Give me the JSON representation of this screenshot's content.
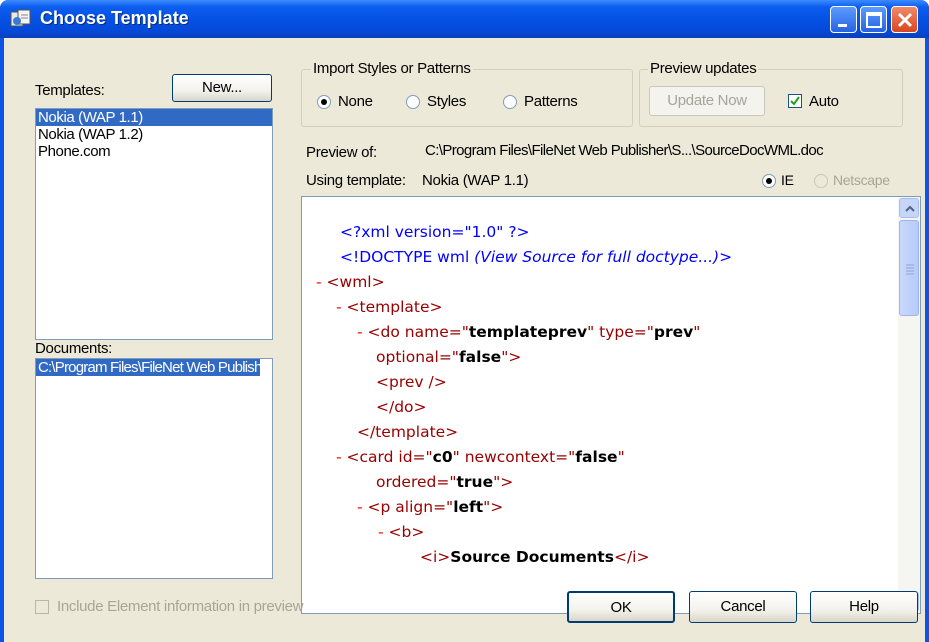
{
  "window": {
    "title": "Choose Template"
  },
  "templates": {
    "label": "Templates:",
    "new_button": "New...",
    "items": [
      "Nokia (WAP 1.1)",
      "Nokia (WAP 1.2)",
      "Phone.com"
    ],
    "selected_index": 0
  },
  "documents": {
    "label": "Documents:",
    "items": [
      "C:\\Program Files\\FileNet Web Publisher\\SourceDocWML.doc"
    ],
    "selected_index": 0
  },
  "import_group": {
    "legend": "Import Styles or Patterns",
    "options": [
      "None",
      "Styles",
      "Patterns"
    ],
    "selected": "None"
  },
  "preview_group": {
    "legend": "Preview updates",
    "update_button": "Update Now",
    "auto_label": "Auto",
    "auto_checked": true
  },
  "preview_of": {
    "label": "Preview of:",
    "value": "C:\\Program Files\\FileNet Web Publisher\\S...\\SourceDocWML.doc"
  },
  "using_template": {
    "label": "Using template:",
    "value": "Nokia (WAP 1.1)"
  },
  "browser": {
    "options": [
      "IE",
      "Netscape"
    ],
    "selected": "IE"
  },
  "code": {
    "l1": "<?xml version=\"1.0\" ?>",
    "l2_a": "<!DOCTYPE wml ",
    "l2_b": "(View Source for full doctype...)",
    "l2_c": ">",
    "minus": "-",
    "wml_open": "<wml>",
    "template_open": "<template>",
    "do_a": "<do ",
    "do_name_attr": "name=\"",
    "do_name_val": "templateprev",
    "do_type_attr": "\" type=\"",
    "do_type_val": "prev",
    "quote": "\"",
    "optional_attr": "optional=\"",
    "optional_val": "false",
    "close_gt": "\">",
    "prev_tag": "<prev />",
    "do_close": "</do>",
    "template_close": "</template>",
    "card_a": "<card ",
    "card_id_attr": "id=\"",
    "card_id_val": "c0",
    "card_nc_attr": "\" newcontext=\"",
    "card_nc_val": "false",
    "ordered_attr": "ordered=\"",
    "ordered_val": "true",
    "p_a": "<p ",
    "p_align_attr": "align=\"",
    "p_align_val": "left",
    "b_open": "<b>",
    "i_open": "<i>",
    "i_text": "Source Documents",
    "i_close": "</i>"
  },
  "include_element": {
    "label": "Include Element information in preview",
    "checked": false,
    "enabled": false
  },
  "buttons": {
    "ok": "OK",
    "cancel": "Cancel",
    "help": "Help"
  },
  "colors": {
    "titlebar": "#0450e3",
    "selection": "#316ac5",
    "tag_red": "#990000",
    "pi_blue": "#0000ff",
    "face": "#ece9d8"
  }
}
